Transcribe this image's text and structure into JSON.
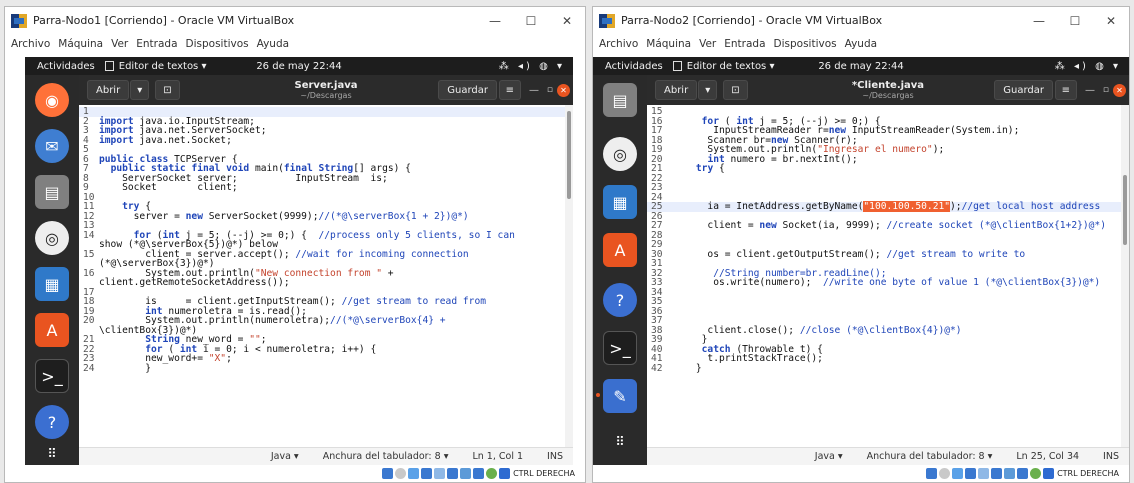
{
  "host_os_title_partial": "",
  "left_window": {
    "title": "Parra-Nodo1 [Corriendo] - Oracle VM VirtualBox",
    "menu": [
      "Archivo",
      "Máquina",
      "Ver",
      "Entrada",
      "Dispositivos",
      "Ayuda"
    ],
    "topbar": {
      "activities": "Actividades",
      "app": "Editor de textos ▾",
      "clock": "26 de may 22:44",
      "tray": "⁂ ◂) ◍ ▾"
    },
    "headerbar": {
      "open": "Abrir",
      "filename": "Server.java",
      "path": "~/Descargas",
      "save": "Guardar"
    },
    "status": {
      "lang": "Java ▾",
      "tab": "Anchura del tabulador: 8 ▾",
      "pos": "Ln 1, Col 1",
      "mode": "INS"
    },
    "host_status": "CTRL DERECHA"
  },
  "right_window": {
    "title": "Parra-Nodo2 [Corriendo] - Oracle VM VirtualBox",
    "menu": [
      "Archivo",
      "Máquina",
      "Ver",
      "Entrada",
      "Dispositivos",
      "Ayuda"
    ],
    "topbar": {
      "activities": "Actividades",
      "app": "Editor de textos ▾",
      "clock": "26 de may 22:44",
      "tray": "⁂ ◂) ◍ ▾"
    },
    "headerbar": {
      "open": "Abrir",
      "filename": "*Cliente.java",
      "path": "~/Descargas",
      "save": "Guardar"
    },
    "status": {
      "lang": "Java ▾",
      "tab": "Anchura del tabulador: 8 ▾",
      "pos": "Ln 25, Col 34",
      "mode": "INS"
    },
    "host_status": "CTRL DERECHA"
  },
  "left_code": [
    {
      "n": "1",
      "t": ""
    },
    {
      "n": "2",
      "t": "import java.io.InputStream;"
    },
    {
      "n": "3",
      "t": "import java.net.ServerSocket;"
    },
    {
      "n": "4",
      "t": "import java.net.Socket;"
    },
    {
      "n": "5",
      "t": ""
    },
    {
      "n": "6",
      "t": "public class TCPServer {"
    },
    {
      "n": "7",
      "t": "  public static final void main(final String[] args) {"
    },
    {
      "n": "8",
      "t": "    ServerSocket server;          InputStream  is;"
    },
    {
      "n": "9",
      "t": "    Socket       client;"
    },
    {
      "n": "10",
      "t": ""
    },
    {
      "n": "11",
      "t": "    try {"
    },
    {
      "n": "12",
      "t": "      server = new ServerSocket(9999);//(*@\\serverBox{1 + 2})@*)"
    },
    {
      "n": "13",
      "t": ""
    },
    {
      "n": "14",
      "t": "      for (int j = 5; (--j) >= 0;) {  //process only 5 clients, so I can"
    },
    {
      "n": "",
      "t": "show (*@\\serverBox{5})@*) below"
    },
    {
      "n": "15",
      "t": "        client = server.accept(); //wait for incoming connection"
    },
    {
      "n": "",
      "t": "(*@\\serverBox{3})@*)"
    },
    {
      "n": "16",
      "t": "        System.out.println(\"New connection from \" +"
    },
    {
      "n": "",
      "t": "client.getRemoteSocketAddress());"
    },
    {
      "n": "17",
      "t": ""
    },
    {
      "n": "18",
      "t": "        is     = client.getInputStream(); //get stream to read from"
    },
    {
      "n": "19",
      "t": "        int numeroletra = is.read();"
    },
    {
      "n": "20",
      "t": "        System.out.println(numeroletra);//(*@\\serverBox{4} +"
    },
    {
      "n": "",
      "t": "\\clientBox{3})@*)"
    },
    {
      "n": "21",
      "t": "        String new_word = \"\";"
    },
    {
      "n": "22",
      "t": "        for ( int i = 0; i < numeroletra; i++) {"
    },
    {
      "n": "23",
      "t": "        new_word+= \"X\";"
    },
    {
      "n": "24",
      "t": "        }"
    }
  ],
  "right_code": [
    {
      "n": "15",
      "t": ""
    },
    {
      "n": "16",
      "t": "      for ( int j = 5; (--j) >= 0;) {"
    },
    {
      "n": "17",
      "t": "        InputStreamReader r=new InputStreamReader(System.in);"
    },
    {
      "n": "18",
      "t": "       Scanner br=new Scanner(r);"
    },
    {
      "n": "19",
      "t": "       System.out.println(\"Ingresar el numero\");"
    },
    {
      "n": "20",
      "t": "       int numero = br.nextInt();"
    },
    {
      "n": "21",
      "t": "     try {"
    },
    {
      "n": "22",
      "t": ""
    },
    {
      "n": "23",
      "t": ""
    },
    {
      "n": "24",
      "t": ""
    },
    {
      "n": "25",
      "t": "       ia = InetAddress.getByName(\"100.100.50.21\");//get local host address"
    },
    {
      "n": "26",
      "t": ""
    },
    {
      "n": "27",
      "t": "       client = new Socket(ia, 9999); //create socket (*@\\clientBox{1+2})@*)"
    },
    {
      "n": "28",
      "t": ""
    },
    {
      "n": "29",
      "t": ""
    },
    {
      "n": "30",
      "t": "       os = client.getOutputStream(); //get stream to write to"
    },
    {
      "n": "31",
      "t": ""
    },
    {
      "n": "32",
      "t": "        //String number=br.readLine();"
    },
    {
      "n": "33",
      "t": "        os.write(numero);  //write one byte of value 1 (*@\\clientBox{3})@*)"
    },
    {
      "n": "34",
      "t": ""
    },
    {
      "n": "35",
      "t": ""
    },
    {
      "n": "36",
      "t": ""
    },
    {
      "n": "37",
      "t": ""
    },
    {
      "n": "38",
      "t": "       client.close(); //close (*@\\clientBox{4})@*)"
    },
    {
      "n": "39",
      "t": "      }"
    },
    {
      "n": "40",
      "t": "      catch (Throwable t) {"
    },
    {
      "n": "41",
      "t": "       t.printStackTrace();"
    },
    {
      "n": "42",
      "t": "     }"
    }
  ],
  "colors": {
    "accent": "#e95420",
    "dock": "#2a2a2a",
    "headerbar": "#2b2b2b"
  }
}
